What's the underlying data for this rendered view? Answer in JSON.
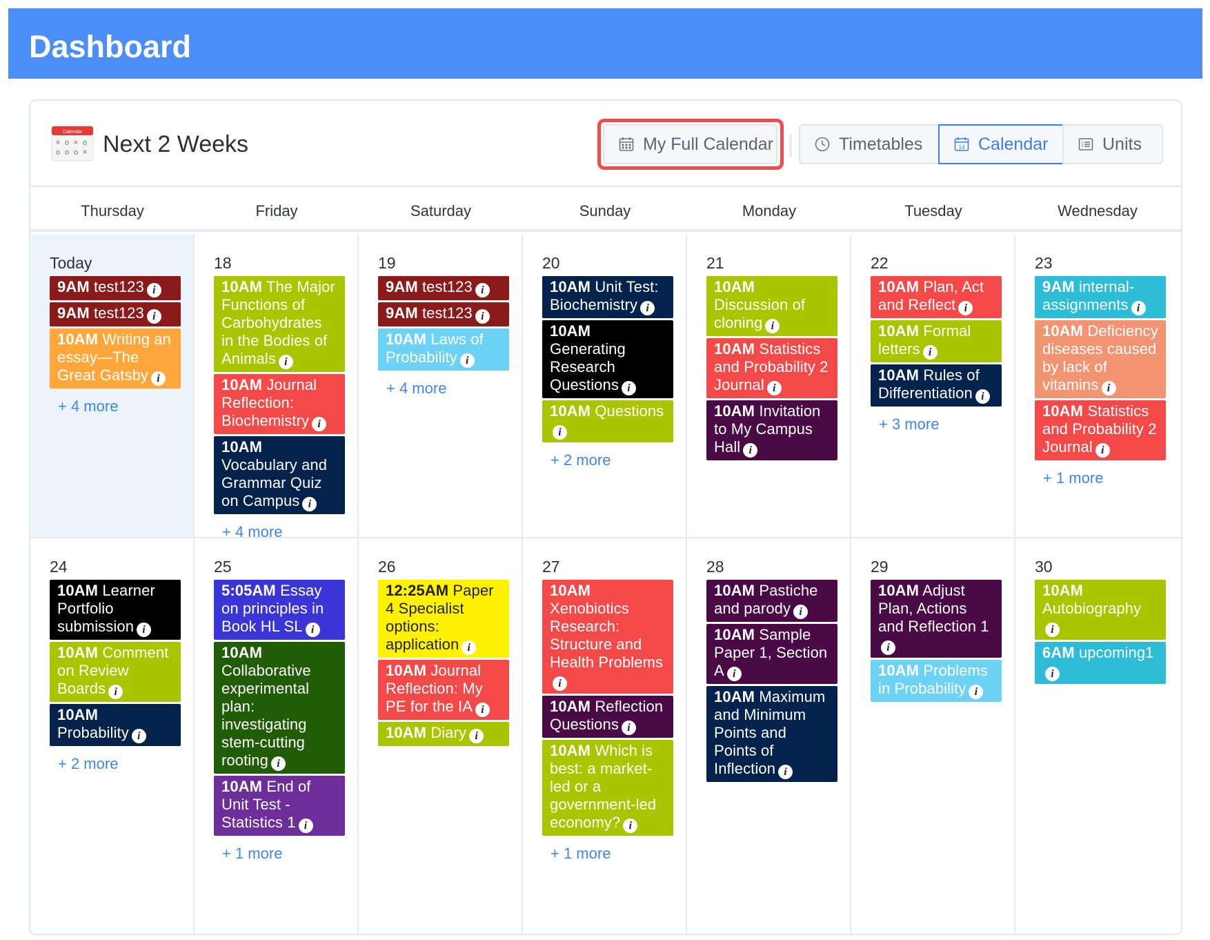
{
  "header": {
    "title": "Dashboard"
  },
  "card": {
    "title": "Next 2 Weeks",
    "logo_label": "Calendar",
    "buttons": {
      "full_calendar": "My Full Calendar",
      "timetables": "Timetables",
      "calendar": "Calendar",
      "units": "Units"
    }
  },
  "weekdays": [
    "Thursday",
    "Friday",
    "Saturday",
    "Sunday",
    "Monday",
    "Tuesday",
    "Wednesday"
  ],
  "colors": {
    "maroon": "#8b1a1a",
    "orange": "#ffa73b",
    "lime": "#a8c500",
    "red": "#f44949",
    "navy": "#03224c",
    "skyblue": "#6cd3f7",
    "black": "#000000",
    "purple_dark": "#4a0a45",
    "teal": "#2dbdd6",
    "salmon": "#f29472",
    "indigo": "#3a35d6",
    "forest": "#215c07",
    "violet": "#6e2e9a",
    "yellow": "#fff200",
    "link": "#3f86e8"
  },
  "weeks": [
    {
      "days": [
        {
          "label": "Today",
          "today": true,
          "events": [
            {
              "time": "9AM",
              "title": "test123",
              "color": "maroon"
            },
            {
              "time": "9AM",
              "title": "test123",
              "color": "maroon"
            },
            {
              "time": "10AM",
              "title": "Writing an essay—The Great Gatsby",
              "color": "orange"
            }
          ],
          "more": "+ 4 more"
        },
        {
          "label": "18",
          "events": [
            {
              "time": "10AM",
              "title": "The Major Functions of Carbohydrates in the Bodies of Animals",
              "color": "lime"
            },
            {
              "time": "10AM",
              "title": "Journal Reflection: Biochemistry",
              "color": "red"
            },
            {
              "time": "10AM",
              "title": "Vocabulary and Grammar Quiz on Campus",
              "color": "navy"
            }
          ],
          "more": "+ 4 more"
        },
        {
          "label": "19",
          "events": [
            {
              "time": "9AM",
              "title": "test123",
              "color": "maroon"
            },
            {
              "time": "9AM",
              "title": "test123",
              "color": "maroon"
            },
            {
              "time": "10AM",
              "title": "Laws of Probability",
              "color": "skyblue"
            }
          ],
          "more": "+ 4 more"
        },
        {
          "label": "20",
          "events": [
            {
              "time": "10AM",
              "title": "Unit Test: Biochemistry",
              "color": "navy"
            },
            {
              "time": "10AM",
              "title": "Generating Research Questions",
              "color": "black"
            },
            {
              "time": "10AM",
              "title": "Questions",
              "color": "lime"
            }
          ],
          "more": "+ 2 more"
        },
        {
          "label": "21",
          "events": [
            {
              "time": "10AM",
              "title": "Discussion of cloning",
              "color": "lime"
            },
            {
              "time": "10AM",
              "title": "Statistics and Probability 2 Journal",
              "color": "red"
            },
            {
              "time": "10AM",
              "title": "Invitation to My Campus Hall",
              "color": "purple_dark"
            }
          ],
          "more": ""
        },
        {
          "label": "22",
          "events": [
            {
              "time": "10AM",
              "title": "Plan, Act and Reflect",
              "color": "red"
            },
            {
              "time": "10AM",
              "title": "Formal letters",
              "color": "lime"
            },
            {
              "time": "10AM",
              "title": "Rules of Differentiation",
              "color": "navy"
            }
          ],
          "more": "+ 3 more"
        },
        {
          "label": "23",
          "events": [
            {
              "time": "9AM",
              "title": "internal-assignments",
              "color": "teal"
            },
            {
              "time": "10AM",
              "title": "Deficiency diseases caused by lack of vitamins",
              "color": "salmon"
            },
            {
              "time": "10AM",
              "title": "Statistics and Probability 2 Journal",
              "color": "red"
            }
          ],
          "more": "+ 1 more"
        }
      ]
    },
    {
      "days": [
        {
          "label": "24",
          "events": [
            {
              "time": "10AM",
              "title": "Learner Portfolio submission",
              "color": "black"
            },
            {
              "time": "10AM",
              "title": "Comment on Review Boards",
              "color": "lime"
            },
            {
              "time": "10AM",
              "title": "Probability",
              "color": "navy"
            }
          ],
          "more": "+ 2 more"
        },
        {
          "label": "25",
          "events": [
            {
              "time": "5:05AM",
              "title": "Essay on principles in Book HL SL",
              "color": "indigo"
            },
            {
              "time": "10AM",
              "title": "Collaborative experimental plan: investigating stem-cutting rooting",
              "color": "forest"
            },
            {
              "time": "10AM",
              "title": "End of Unit Test - Statistics 1",
              "color": "violet"
            }
          ],
          "more": "+ 1 more"
        },
        {
          "label": "26",
          "events": [
            {
              "time": "12:25AM",
              "title": "Paper 4 Specialist options: application",
              "color": "yellow"
            },
            {
              "time": "10AM",
              "title": "Journal Reflection: My PE for the IA",
              "color": "red"
            },
            {
              "time": "10AM",
              "title": "Diary",
              "color": "lime"
            }
          ],
          "more": ""
        },
        {
          "label": "27",
          "events": [
            {
              "time": "10AM",
              "title": "Xenobiotics Research: Structure and Health Problems",
              "color": "red"
            },
            {
              "time": "10AM",
              "title": "Reflection Questions",
              "color": "purple_dark"
            },
            {
              "time": "10AM",
              "title": "Which is best: a market-led or a government-led economy?",
              "color": "lime"
            }
          ],
          "more": "+ 1 more"
        },
        {
          "label": "28",
          "events": [
            {
              "time": "10AM",
              "title": "Pastiche and parody",
              "color": "purple_dark"
            },
            {
              "time": "10AM",
              "title": "Sample Paper 1, Section A",
              "color": "purple_dark"
            },
            {
              "time": "10AM",
              "title": "Maximum and Minimum Points and Points of Inflection",
              "color": "navy"
            }
          ],
          "more": ""
        },
        {
          "label": "29",
          "events": [
            {
              "time": "10AM",
              "title": "Adjust Plan, Actions and Reflection 1",
              "color": "purple_dark"
            },
            {
              "time": "10AM",
              "title": "Problems in Probability",
              "color": "skyblue"
            }
          ],
          "more": ""
        },
        {
          "label": "30",
          "events": [
            {
              "time": "10AM",
              "title": "Autobiography",
              "color": "lime"
            },
            {
              "time": "6AM",
              "title": "upcoming1",
              "color": "teal"
            }
          ],
          "more": ""
        }
      ]
    }
  ]
}
